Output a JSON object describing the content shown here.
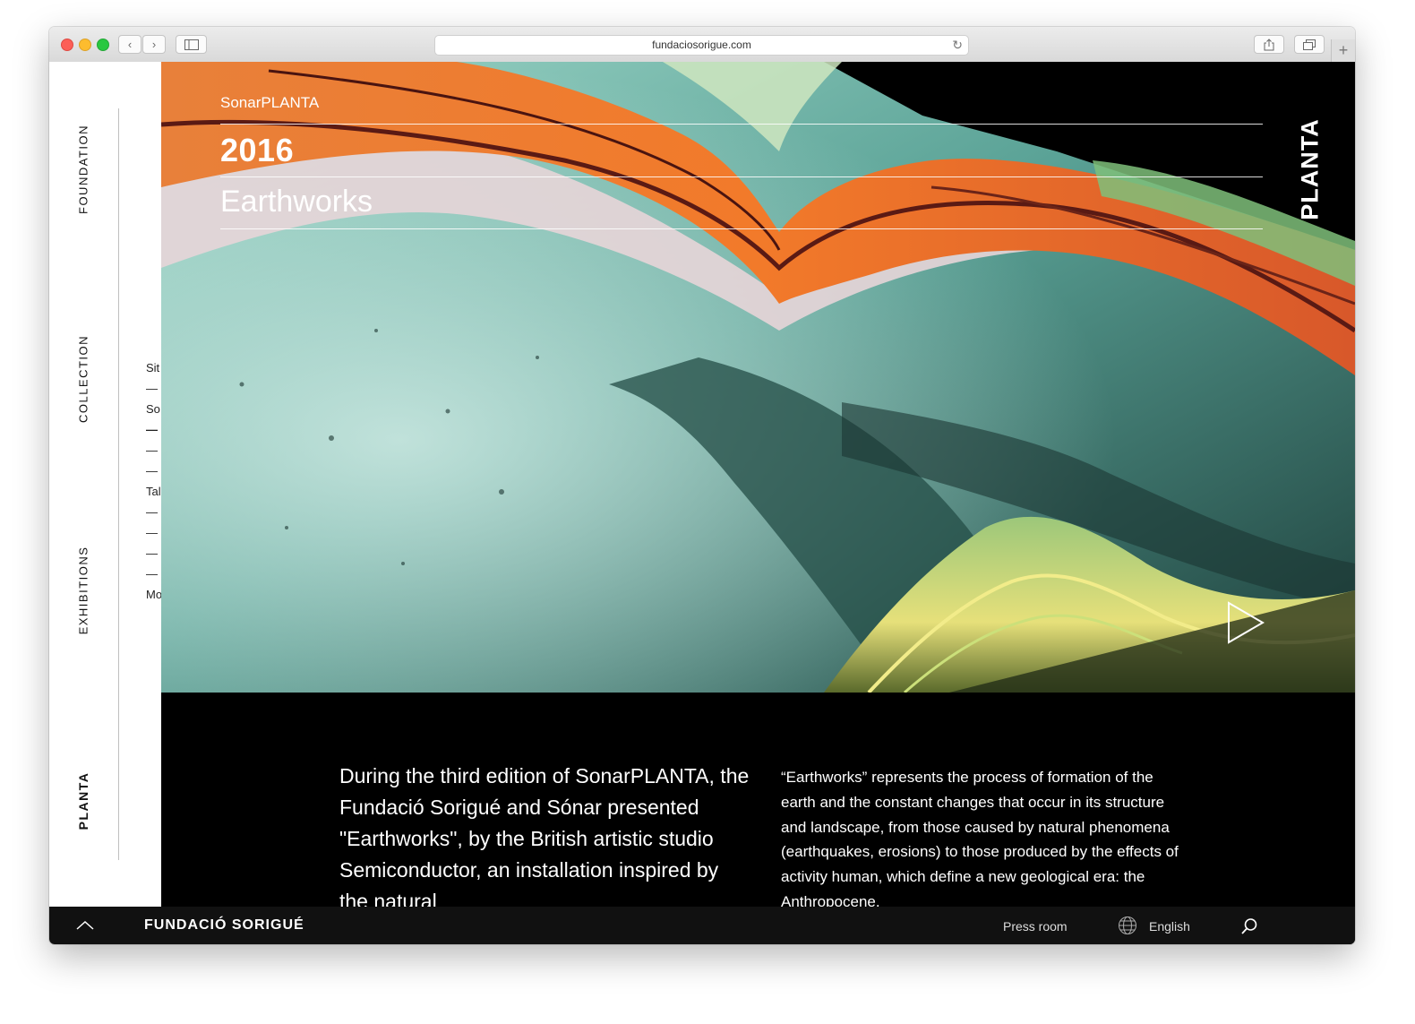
{
  "browser": {
    "url": "fundaciosorigue.com",
    "back_icon": "chevron-left-icon",
    "forward_icon": "chevron-right-icon",
    "newtab_label": "+"
  },
  "sidenav": {
    "items": [
      {
        "label": "FOUNDATION"
      },
      {
        "label": "COLLECTION"
      },
      {
        "label": "EXHIBITIONS"
      },
      {
        "label": "PLANTA",
        "active": true
      }
    ],
    "sub": [
      "Sit",
      "—",
      "So",
      "—",
      "—",
      "—",
      "Tal",
      "—",
      "—",
      "—",
      "—",
      "Mo"
    ]
  },
  "hero": {
    "subtitle": "SonarPLANTA",
    "year": "2016",
    "title": "Earthworks",
    "logo": "PLANTA"
  },
  "text": {
    "lead": "During the third edition of SonarPLANTA, the Fundació Sorigué and Sónar presented \"Earthworks\", by the British artistic studio Semiconductor, an installation inspired by the natural",
    "body": "“Earthworks” represents the process of formation of the earth and the constant changes that occur in its structure and landscape, from those caused by natural phenomena (earthquakes, erosions) to those produced by the effects of activity human, which define a new geological era: the Anthropocene."
  },
  "footer": {
    "brand": "FUNDACIÓ SORIGUÉ",
    "press": "Press room",
    "language": "English"
  }
}
